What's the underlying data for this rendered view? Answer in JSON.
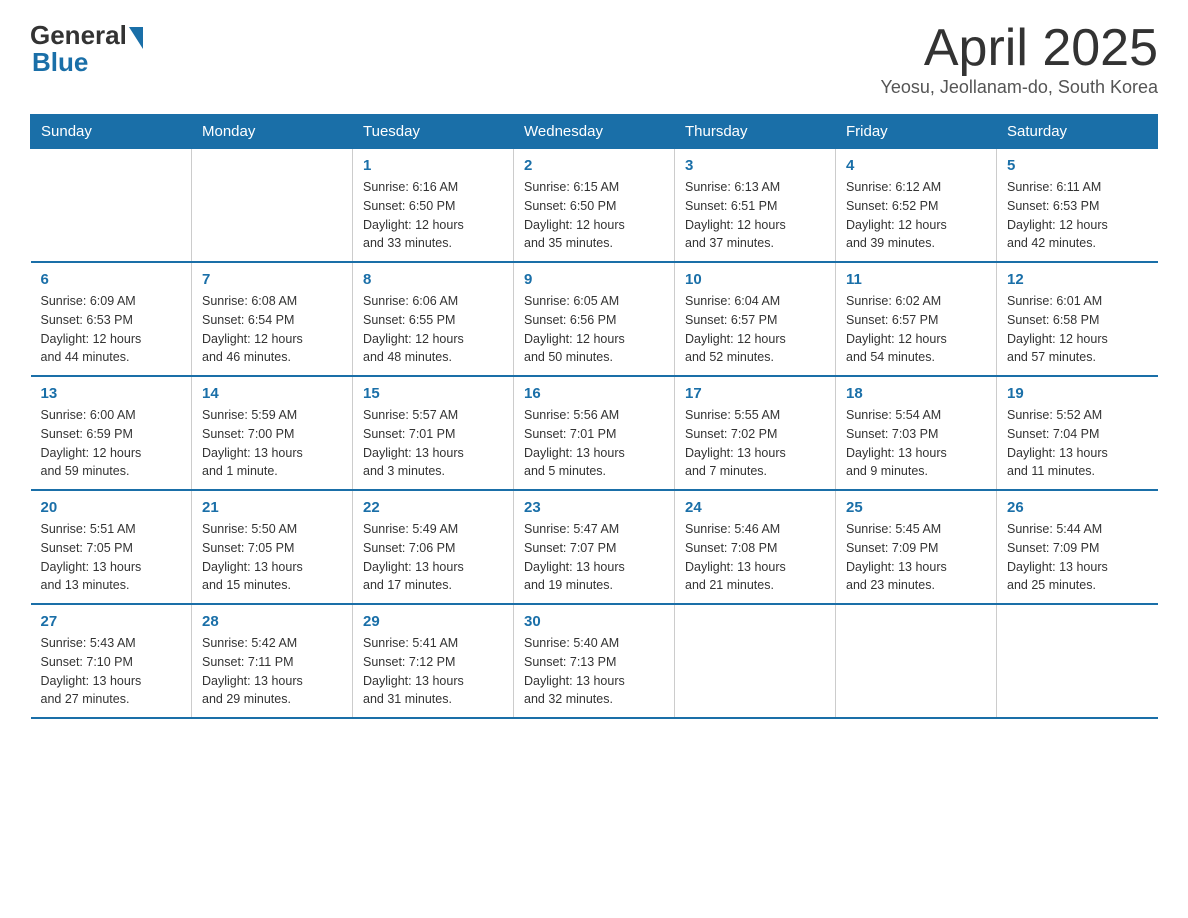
{
  "header": {
    "logo_general": "General",
    "logo_blue": "Blue",
    "title": "April 2025",
    "subtitle": "Yeosu, Jeollanam-do, South Korea"
  },
  "days_of_week": [
    "Sunday",
    "Monday",
    "Tuesday",
    "Wednesday",
    "Thursday",
    "Friday",
    "Saturday"
  ],
  "weeks": [
    [
      {
        "day": "",
        "info": ""
      },
      {
        "day": "",
        "info": ""
      },
      {
        "day": "1",
        "info": "Sunrise: 6:16 AM\nSunset: 6:50 PM\nDaylight: 12 hours\nand 33 minutes."
      },
      {
        "day": "2",
        "info": "Sunrise: 6:15 AM\nSunset: 6:50 PM\nDaylight: 12 hours\nand 35 minutes."
      },
      {
        "day": "3",
        "info": "Sunrise: 6:13 AM\nSunset: 6:51 PM\nDaylight: 12 hours\nand 37 minutes."
      },
      {
        "day": "4",
        "info": "Sunrise: 6:12 AM\nSunset: 6:52 PM\nDaylight: 12 hours\nand 39 minutes."
      },
      {
        "day": "5",
        "info": "Sunrise: 6:11 AM\nSunset: 6:53 PM\nDaylight: 12 hours\nand 42 minutes."
      }
    ],
    [
      {
        "day": "6",
        "info": "Sunrise: 6:09 AM\nSunset: 6:53 PM\nDaylight: 12 hours\nand 44 minutes."
      },
      {
        "day": "7",
        "info": "Sunrise: 6:08 AM\nSunset: 6:54 PM\nDaylight: 12 hours\nand 46 minutes."
      },
      {
        "day": "8",
        "info": "Sunrise: 6:06 AM\nSunset: 6:55 PM\nDaylight: 12 hours\nand 48 minutes."
      },
      {
        "day": "9",
        "info": "Sunrise: 6:05 AM\nSunset: 6:56 PM\nDaylight: 12 hours\nand 50 minutes."
      },
      {
        "day": "10",
        "info": "Sunrise: 6:04 AM\nSunset: 6:57 PM\nDaylight: 12 hours\nand 52 minutes."
      },
      {
        "day": "11",
        "info": "Sunrise: 6:02 AM\nSunset: 6:57 PM\nDaylight: 12 hours\nand 54 minutes."
      },
      {
        "day": "12",
        "info": "Sunrise: 6:01 AM\nSunset: 6:58 PM\nDaylight: 12 hours\nand 57 minutes."
      }
    ],
    [
      {
        "day": "13",
        "info": "Sunrise: 6:00 AM\nSunset: 6:59 PM\nDaylight: 12 hours\nand 59 minutes."
      },
      {
        "day": "14",
        "info": "Sunrise: 5:59 AM\nSunset: 7:00 PM\nDaylight: 13 hours\nand 1 minute."
      },
      {
        "day": "15",
        "info": "Sunrise: 5:57 AM\nSunset: 7:01 PM\nDaylight: 13 hours\nand 3 minutes."
      },
      {
        "day": "16",
        "info": "Sunrise: 5:56 AM\nSunset: 7:01 PM\nDaylight: 13 hours\nand 5 minutes."
      },
      {
        "day": "17",
        "info": "Sunrise: 5:55 AM\nSunset: 7:02 PM\nDaylight: 13 hours\nand 7 minutes."
      },
      {
        "day": "18",
        "info": "Sunrise: 5:54 AM\nSunset: 7:03 PM\nDaylight: 13 hours\nand 9 minutes."
      },
      {
        "day": "19",
        "info": "Sunrise: 5:52 AM\nSunset: 7:04 PM\nDaylight: 13 hours\nand 11 minutes."
      }
    ],
    [
      {
        "day": "20",
        "info": "Sunrise: 5:51 AM\nSunset: 7:05 PM\nDaylight: 13 hours\nand 13 minutes."
      },
      {
        "day": "21",
        "info": "Sunrise: 5:50 AM\nSunset: 7:05 PM\nDaylight: 13 hours\nand 15 minutes."
      },
      {
        "day": "22",
        "info": "Sunrise: 5:49 AM\nSunset: 7:06 PM\nDaylight: 13 hours\nand 17 minutes."
      },
      {
        "day": "23",
        "info": "Sunrise: 5:47 AM\nSunset: 7:07 PM\nDaylight: 13 hours\nand 19 minutes."
      },
      {
        "day": "24",
        "info": "Sunrise: 5:46 AM\nSunset: 7:08 PM\nDaylight: 13 hours\nand 21 minutes."
      },
      {
        "day": "25",
        "info": "Sunrise: 5:45 AM\nSunset: 7:09 PM\nDaylight: 13 hours\nand 23 minutes."
      },
      {
        "day": "26",
        "info": "Sunrise: 5:44 AM\nSunset: 7:09 PM\nDaylight: 13 hours\nand 25 minutes."
      }
    ],
    [
      {
        "day": "27",
        "info": "Sunrise: 5:43 AM\nSunset: 7:10 PM\nDaylight: 13 hours\nand 27 minutes."
      },
      {
        "day": "28",
        "info": "Sunrise: 5:42 AM\nSunset: 7:11 PM\nDaylight: 13 hours\nand 29 minutes."
      },
      {
        "day": "29",
        "info": "Sunrise: 5:41 AM\nSunset: 7:12 PM\nDaylight: 13 hours\nand 31 minutes."
      },
      {
        "day": "30",
        "info": "Sunrise: 5:40 AM\nSunset: 7:13 PM\nDaylight: 13 hours\nand 32 minutes."
      },
      {
        "day": "",
        "info": ""
      },
      {
        "day": "",
        "info": ""
      },
      {
        "day": "",
        "info": ""
      }
    ]
  ]
}
